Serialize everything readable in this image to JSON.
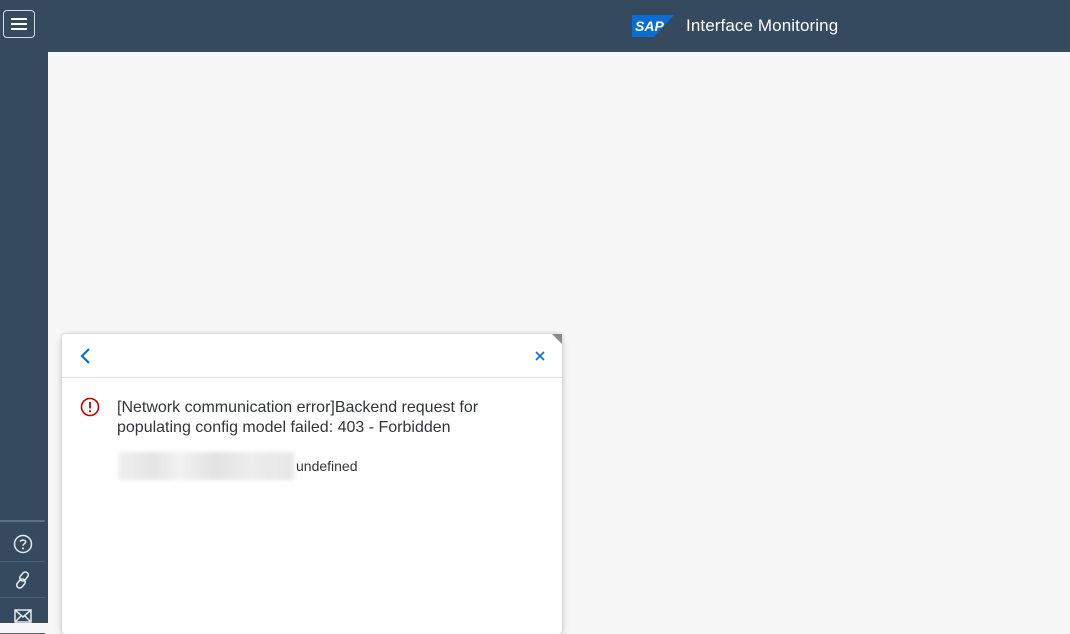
{
  "shell": {
    "menu_icon": "hamburger-icon",
    "logo_text": "SAP",
    "app_title": "Interface Monitoring",
    "colors": {
      "shell_bg": "#354a5f",
      "logo_blue": "#0a6ed1",
      "error": "#bb0000"
    }
  },
  "sidebar": {
    "buttons": [
      {
        "icon": "help-icon"
      },
      {
        "icon": "link-icon"
      },
      {
        "icon": "email-icon"
      }
    ]
  },
  "popover": {
    "back_icon": "chevron-left-icon",
    "close_icon": "close-icon",
    "message_icon": "error-icon",
    "message": "[Network communication error]Backend request for populating config model failed: 403 - Forbidden",
    "detail": "undefined"
  }
}
